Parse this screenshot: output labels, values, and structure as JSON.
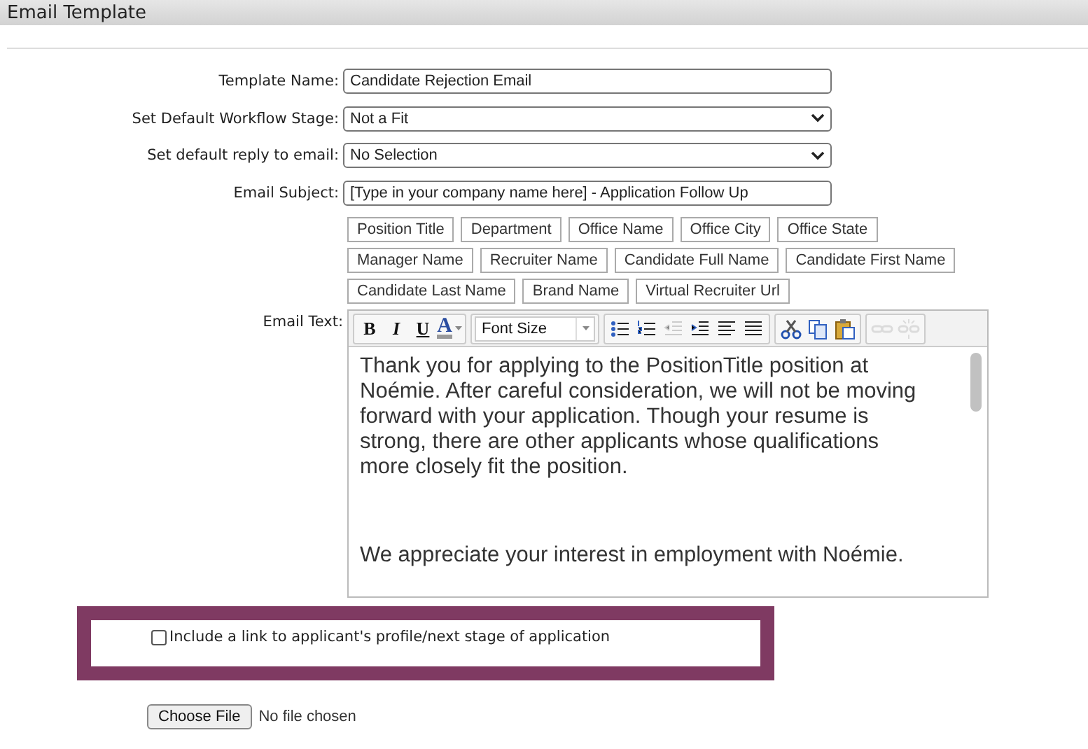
{
  "window": {
    "title": "Email Template"
  },
  "form": {
    "fields": [
      {
        "kind": "text",
        "label": "Template Name:",
        "value": "Candidate Rejection Email"
      },
      {
        "kind": "select",
        "label": "Set Default Workflow Stage:",
        "value": "Not a Fit"
      },
      {
        "kind": "select",
        "label": "Set default reply to email:",
        "value": "No Selection"
      },
      {
        "kind": "text",
        "label": "Email Subject:",
        "value": "[Type in your company name here] - Application Follow Up"
      }
    ],
    "tag_rows": [
      [
        "Position Title",
        "Department",
        "Office Name",
        "Office City",
        "Office State"
      ],
      [
        "Manager Name",
        "Recruiter Name",
        "Candidate Full Name",
        "Candidate First Name"
      ],
      [
        "Candidate Last Name",
        "Brand Name",
        "Virtual Recruiter Url"
      ]
    ],
    "editor": {
      "label": "Email Text:",
      "toolbar": [
        [
          {
            "kind": "bold",
            "label": "B",
            "disabled": false
          },
          {
            "kind": "italic",
            "label": "I",
            "disabled": false
          },
          {
            "kind": "underline",
            "label": "U",
            "disabled": false
          },
          {
            "kind": "color",
            "label": "A",
            "disabled": false
          }
        ],
        [
          {
            "kind": "dropdown",
            "label": "Font Size",
            "disabled": false
          }
        ],
        [
          {
            "kind": "bullets",
            "disabled": false
          },
          {
            "kind": "numbers",
            "disabled": false
          },
          {
            "kind": "outdent",
            "disabled": true
          },
          {
            "kind": "indent",
            "disabled": false
          },
          {
            "kind": "align-left",
            "disabled": false
          },
          {
            "kind": "justify",
            "disabled": false
          }
        ],
        [
          {
            "kind": "cut",
            "disabled": false
          },
          {
            "kind": "copy",
            "disabled": false
          },
          {
            "kind": "paste",
            "disabled": false
          }
        ],
        [
          {
            "kind": "link",
            "disabled": true
          },
          {
            "kind": "unlink",
            "disabled": true
          }
        ]
      ],
      "paragraphs": [
        "Thank you for applying to the PositionTitle position at Noémie. After careful consideration, we will not be moving forward with your application. Though your resume is strong, there are other applicants whose qualifications more closely fit the position.",
        "We appreciate your interest in employment with Noémie."
      ]
    },
    "link_option": {
      "label": "Include a link to applicant's profile/next stage of application",
      "checked": false
    },
    "attachment": {
      "button": "Choose File",
      "status": "No file chosen"
    }
  }
}
